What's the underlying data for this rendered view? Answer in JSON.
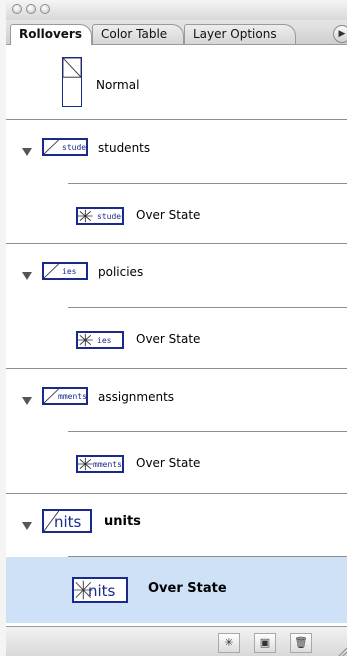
{
  "tabs": [
    {
      "label": "Rollovers"
    },
    {
      "label": "Color Table"
    },
    {
      "label": "Layer Options"
    }
  ],
  "rows": {
    "normal": {
      "label": "Normal"
    },
    "students": {
      "label": "students",
      "thumb_text": "students"
    },
    "students_over": {
      "label": "Over State",
      "thumb_text": "students"
    },
    "policies": {
      "label": "policies",
      "thumb_text": "ies"
    },
    "policies_over": {
      "label": "Over State",
      "thumb_text": "ies"
    },
    "assignments": {
      "label": "assignments",
      "thumb_text": "mments"
    },
    "assignments_over": {
      "label": "Over State",
      "thumb_text": "mments"
    },
    "units": {
      "label": "units",
      "thumb_text": "nits"
    },
    "units_over": {
      "label": "Over State",
      "thumb_text": "nits"
    }
  },
  "selected_row": "units_over",
  "colors": {
    "selection": "#cfe1f7",
    "thumbnail_border": "#1a2a8c"
  },
  "icons": {
    "menu": "triangle-right-icon",
    "new_state": "star-burst-icon",
    "new_layer": "page-icon",
    "delete": "trash-icon"
  }
}
